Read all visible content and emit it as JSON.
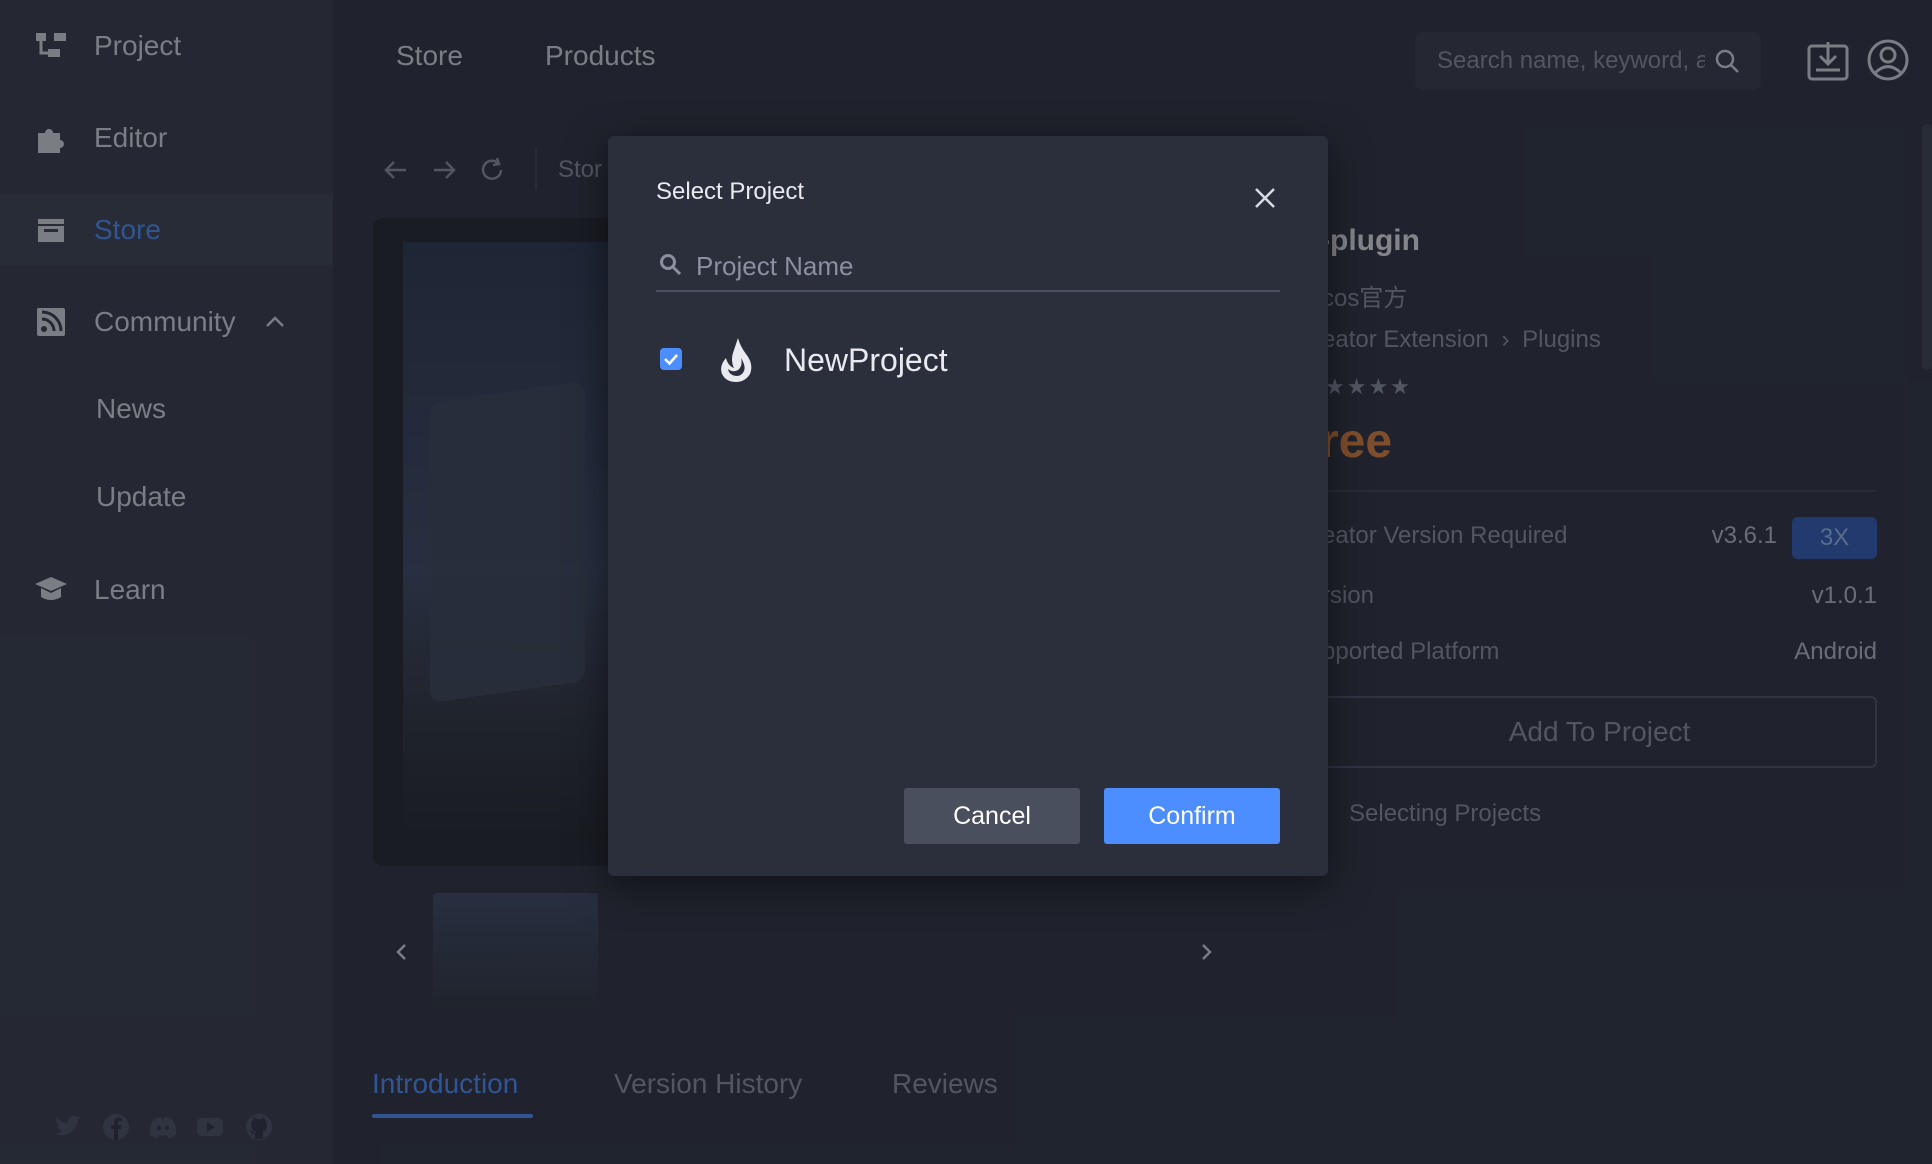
{
  "sidebar": {
    "items": [
      {
        "label": "Project",
        "icon": "project-tree-icon"
      },
      {
        "label": "Editor",
        "icon": "puzzle-icon"
      },
      {
        "label": "Store",
        "icon": "store-icon"
      },
      {
        "label": "Community",
        "icon": "rss-icon"
      },
      {
        "label": "Learn",
        "icon": "graduation-cap-icon"
      }
    ],
    "community_sub": [
      "News",
      "Update"
    ],
    "social_icons": [
      "twitter-icon",
      "facebook-icon",
      "discord-icon",
      "youtube-icon",
      "github-icon"
    ]
  },
  "topnav": {
    "store": "Store",
    "products": "Products",
    "search_placeholder": "Search name, keyword, a"
  },
  "breadcrumb": {
    "first": "Stor"
  },
  "product": {
    "title": "-plugin",
    "author": "cos官方",
    "category_1": "eator Extension",
    "category_2": "Plugins",
    "stars": "★★★★",
    "price": "ree",
    "rows": [
      {
        "label": "eator Version Required",
        "value": "v3.6.1"
      },
      {
        "label": "rsion",
        "value": "v1.0.1"
      },
      {
        "label": "pported Platform",
        "value": "Android"
      }
    ],
    "badge": "3X",
    "add_button": "Add To Project",
    "selecting": "Selecting Projects"
  },
  "tabs": [
    "Introduction",
    "Version History",
    "Reviews"
  ],
  "modal": {
    "title": "Select Project",
    "search_placeholder": "Project Name",
    "project_name": "NewProject",
    "cancel": "Cancel",
    "confirm": "Confirm"
  },
  "colors": {
    "accent": "#4c8dff",
    "price": "#e0803b",
    "background": "#2b2f3c",
    "sidebar": "#343947"
  }
}
